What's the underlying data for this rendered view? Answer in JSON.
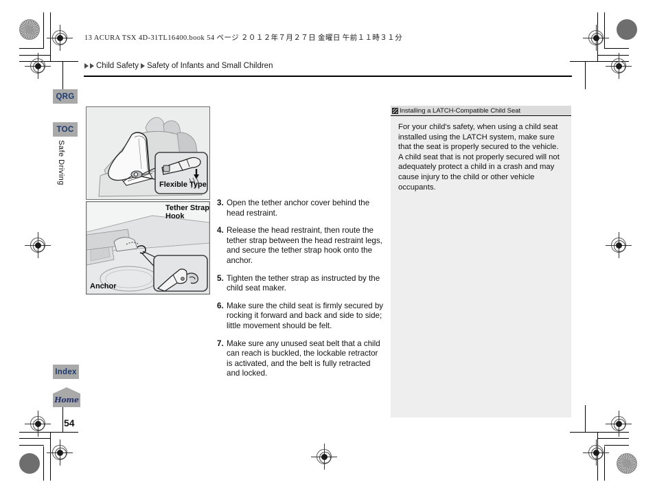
{
  "print_header": "13 ACURA TSX 4D-31TL16400.book   54 ページ   ２０１２年７月２７日   金曜日   午前１１時３１分",
  "breadcrumb": {
    "level1": "Child Safety",
    "level2": "Safety of Infants and Small Children"
  },
  "sidebar": {
    "qrg": "QRG",
    "toc": "TOC",
    "section_label": "Safe Driving",
    "index": "Index",
    "home": "Home"
  },
  "page_number": "54",
  "figures": [
    {
      "id": "figure-1",
      "caption": "Flexible Type",
      "description": "child-seat-tether-on-rear-seat"
    },
    {
      "id": "figure-2",
      "caption_hook": "Tether Strap\nHook",
      "caption_anchor": "Anchor",
      "description": "rear-shelf-tether-anchor"
    }
  ],
  "steps": [
    {
      "num": "3.",
      "text": "Open the tether anchor cover behind the head restraint."
    },
    {
      "num": "4.",
      "text": "Release the head restraint, then route the tether strap between the head restraint legs, and secure the tether strap hook onto the anchor."
    },
    {
      "num": "5.",
      "text": "Tighten the tether strap as instructed by the child seat maker."
    },
    {
      "num": "6.",
      "text": "Make sure the child seat is firmly secured by rocking it forward and back and side to side; little movement should be felt."
    },
    {
      "num": "7.",
      "text": "Make sure any unused seat belt that a child can reach is buckled, the lockable retractor is activated, and the belt is fully retracted and locked."
    }
  ],
  "info_panel": {
    "title": "Installing a LATCH-Compatible Child Seat",
    "body": "For your child's safety, when using a child seat installed using the LATCH system, make sure that the seat is properly secured to the vehicle. A child seat that is not properly secured will not adequately protect a child in a crash and may cause injury to the child or other vehicle occupants."
  },
  "colors": {
    "tab_gray": "#a9a9a9",
    "tab_navy": "#1f3a6e",
    "info_bg": "#eeeeee",
    "info_head": "#dcdcdc",
    "figure_bg": "#eceded"
  }
}
